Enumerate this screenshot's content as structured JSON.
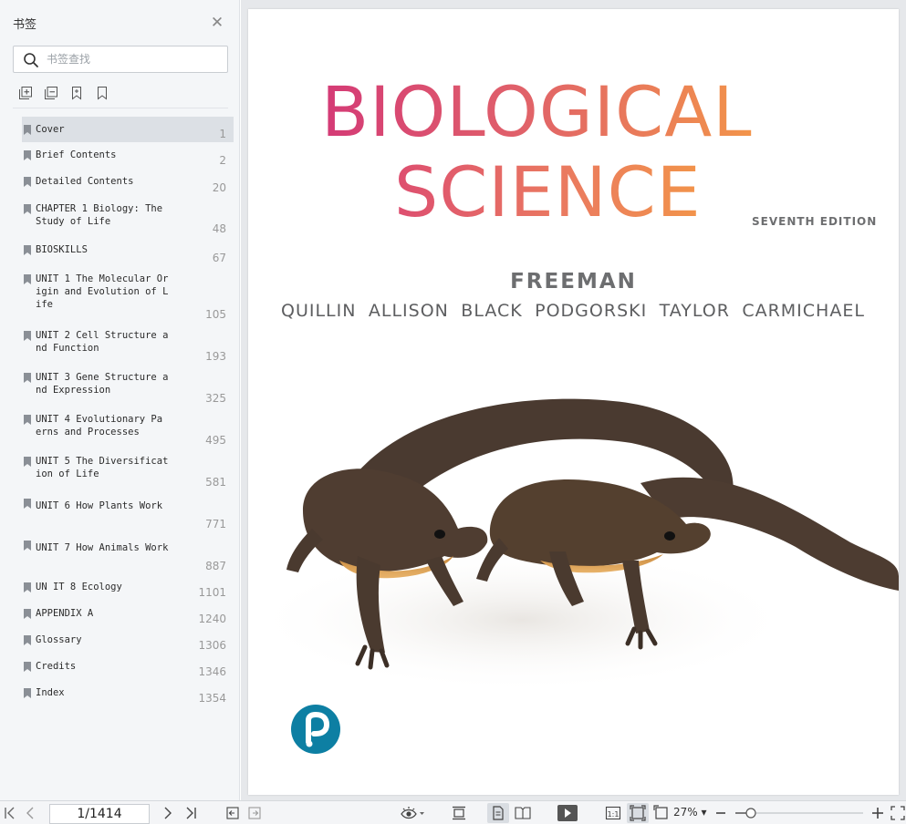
{
  "sidebar": {
    "title": "书签",
    "search_placeholder": "书签查找",
    "bookmarks": [
      {
        "label": "Cover",
        "page": "1"
      },
      {
        "label": "Brief Contents",
        "page": "2"
      },
      {
        "label": "Detailed Contents",
        "page": "20"
      },
      {
        "label": "CHAPTER 1 Biology: The Study of Life",
        "page": "48"
      },
      {
        "label": "BIOSKILLS",
        "page": "67"
      },
      {
        "label": "UNIT 1 The Molecular Origin and Evolution of Life",
        "page": "105"
      },
      {
        "label": "UNIT 2 Cell Structure and Function",
        "page": "193"
      },
      {
        "label": "UNIT 3 Gene Structure and Expression",
        "page": "325"
      },
      {
        "label": "UNIT 4 Evolutionary Pa erns and Processes",
        "page": "495"
      },
      {
        "label": "UNIT 5 The Diversification of Life",
        "page": "581"
      },
      {
        "label": "UNIT 6 How Plants Work",
        "page": "771"
      },
      {
        "label": "UNIT 7 How Animals Work",
        "page": "887"
      },
      {
        "label": "UN IT 8 Ecology",
        "page": "1101"
      },
      {
        "label": "APPENDIX A",
        "page": "1240"
      },
      {
        "label": "Glossary",
        "page": "1306"
      },
      {
        "label": "Credits",
        "page": "1346"
      },
      {
        "label": "Index",
        "page": "1354"
      }
    ]
  },
  "cover": {
    "title_line1": "BIOLOGICAL",
    "title_line2": "SCIENCE",
    "edition": "SEVENTH EDITION",
    "lead_author": "FREEMAN",
    "authors": [
      "QUILLIN",
      "ALLISON",
      "BLACK",
      "PODGORSKI",
      "TAYLOR",
      "CARMICHAEL"
    ],
    "title_gradient": [
      "#d43a76",
      "#f2944a"
    ],
    "logo_color": "#0d7fa3"
  },
  "toolbar": {
    "page_indicator": "1/1414",
    "zoom": "27%",
    "zoom_level": 0.12
  },
  "colors": {
    "sidebar_bg": "#f4f6f8",
    "selected_bg": "#dce0e5",
    "doc_bg": "#e6e8eb"
  }
}
